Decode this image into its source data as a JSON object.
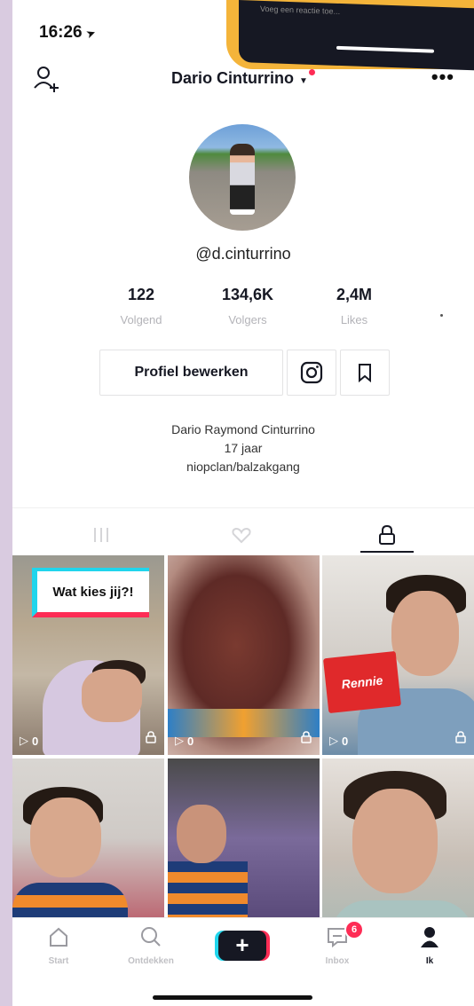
{
  "status": {
    "time": "16:26"
  },
  "overlay": {
    "comment_placeholder": "Voeg een reactie toe..."
  },
  "header": {
    "username": "Dario Cinturrino"
  },
  "profile": {
    "handle": "@d.cinturrino"
  },
  "stats": [
    {
      "value": "122",
      "label": "Volgend"
    },
    {
      "value": "134,6K",
      "label": "Volgers"
    },
    {
      "value": "2,4M",
      "label": "Likes"
    }
  ],
  "buttons": {
    "edit_profile": "Profiel bewerken"
  },
  "bio": {
    "name": "Dario Raymond Cinturrino",
    "age": "17 jaar",
    "line3": "niopclan/balzakgang"
  },
  "videos": [
    {
      "views": "0",
      "sticker": "Wat kies jij?!"
    },
    {
      "views": "0"
    },
    {
      "views": "0",
      "product": "Rennie"
    },
    {
      "views": ""
    },
    {
      "views": ""
    },
    {
      "views": ""
    }
  ],
  "nav": [
    {
      "label": "Start",
      "icon": "home-icon"
    },
    {
      "label": "Ontdekken",
      "icon": "search-icon"
    },
    {
      "label": "",
      "icon": "plus-icon"
    },
    {
      "label": "Inbox",
      "icon": "inbox-icon",
      "badge": "6"
    },
    {
      "label": "Ik",
      "icon": "profile-icon"
    }
  ],
  "colors": {
    "accent_red": "#fe2c55",
    "accent_cyan": "#20d5ec",
    "text_dark": "#161823"
  }
}
